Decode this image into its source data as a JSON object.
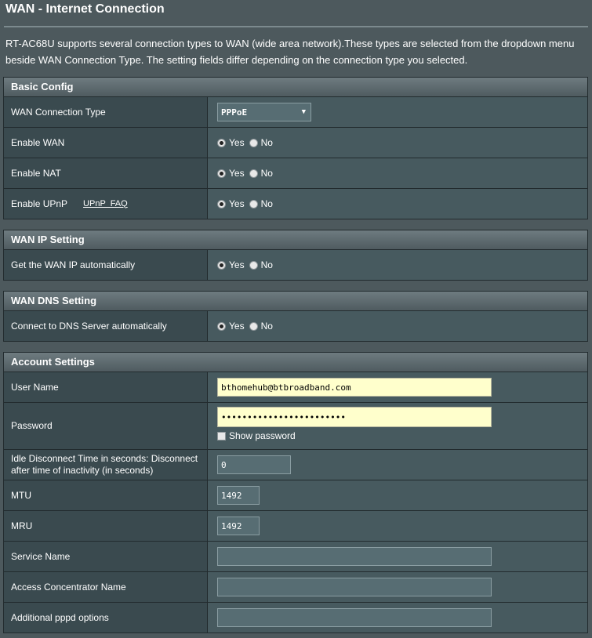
{
  "page": {
    "title": "WAN - Internet Connection",
    "description": "RT-AC68U supports several connection types to WAN (wide area network).These types are selected from the dropdown menu beside WAN Connection Type. The setting fields differ depending on the connection type you selected."
  },
  "radio": {
    "yes": "Yes",
    "no": "No"
  },
  "basic_config": {
    "header": "Basic Config",
    "wan_type_label": "WAN Connection Type",
    "wan_type_value": "PPPoE",
    "enable_wan_label": "Enable WAN",
    "enable_nat_label": "Enable NAT",
    "enable_upnp_label": "Enable UPnP",
    "upnp_faq": "UPnP  FAQ"
  },
  "wan_ip": {
    "header": "WAN IP Setting",
    "auto_ip_label": "Get the WAN IP automatically"
  },
  "wan_dns": {
    "header": "WAN DNS Setting",
    "auto_dns_label": "Connect to DNS Server automatically"
  },
  "account": {
    "header": "Account Settings",
    "username_label": "User Name",
    "username_value": "bthomehub@btbroadband.com",
    "password_label": "Password",
    "password_value": "••••••••••••••••••••••••",
    "show_password": "Show password",
    "idle_label": "Idle Disconnect Time in seconds: Disconnect after time of inactivity (in seconds)",
    "idle_value": "0",
    "mtu_label": "MTU",
    "mtu_value": "1492",
    "mru_label": "MRU",
    "mru_value": "1492",
    "service_name_label": "Service Name",
    "service_name_value": "",
    "ac_name_label": "Access Concentrator Name",
    "ac_name_value": "",
    "pppd_label": "Additional pppd options",
    "pppd_value": ""
  }
}
